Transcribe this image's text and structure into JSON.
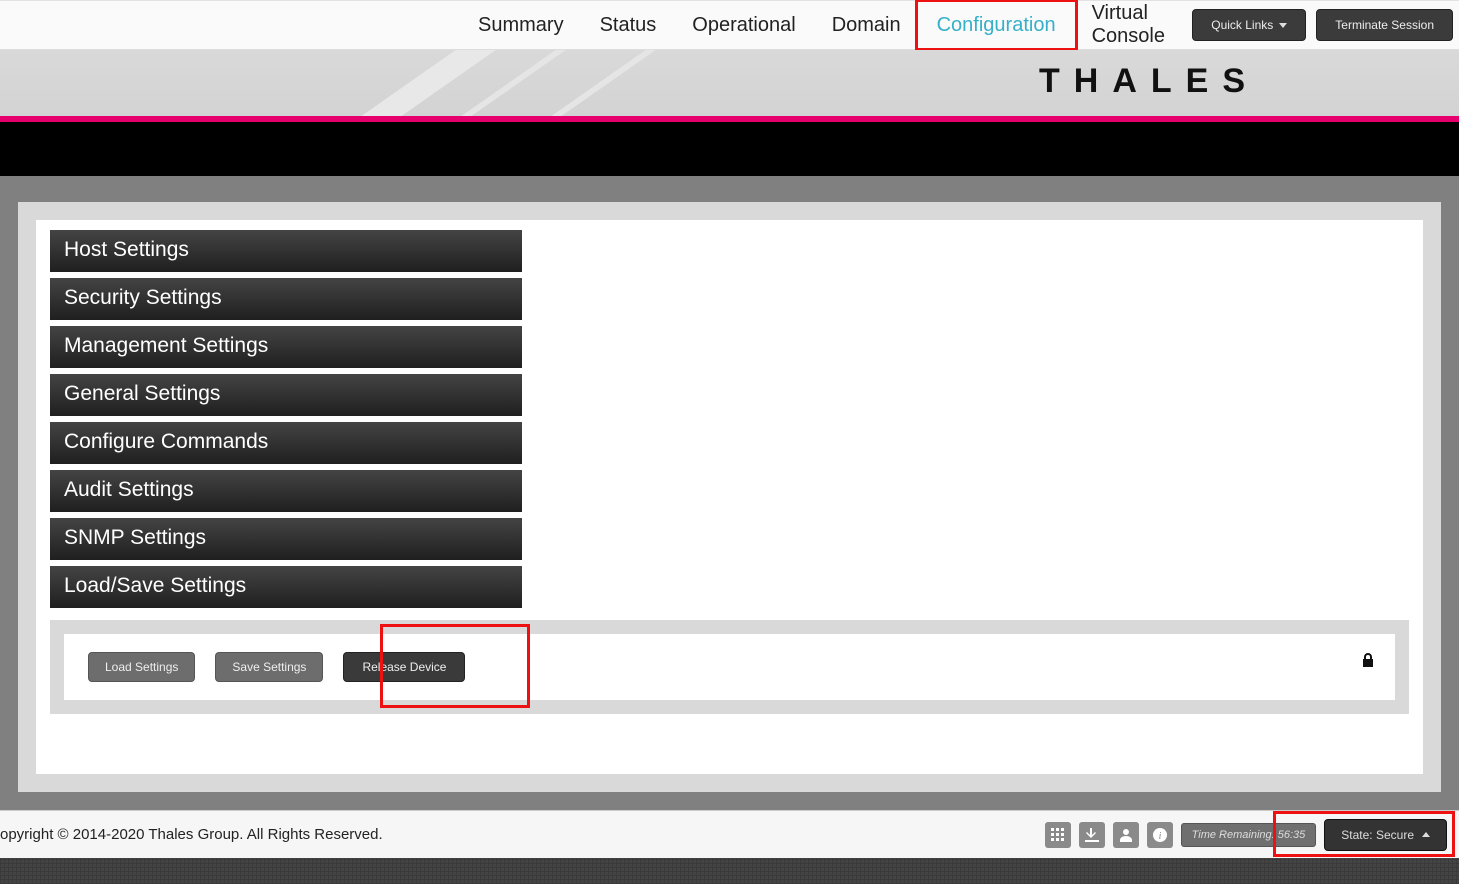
{
  "nav": {
    "tabs": [
      "Summary",
      "Status",
      "Operational",
      "Domain",
      "Configuration",
      "Virtual Console"
    ],
    "active_index": 4,
    "quick_links": "Quick Links",
    "terminate": "Terminate Session"
  },
  "brand": "THALES",
  "accordion": [
    "Host Settings",
    "Security Settings",
    "Management Settings",
    "General Settings",
    "Configure Commands",
    "Audit Settings",
    "SNMP Settings",
    "Load/Save Settings"
  ],
  "actions": {
    "load": "Load Settings",
    "save": "Save Settings",
    "release": "Release Device"
  },
  "footer": {
    "copyright": "opyright © 2014-2020 Thales Group. All Rights Reserved.",
    "time_label": "Time Remaining:",
    "time_value": "56:35",
    "state": "State: Secure"
  },
  "highlights": {
    "configuration_tab": true,
    "release_device_button": true,
    "state_button": true
  }
}
